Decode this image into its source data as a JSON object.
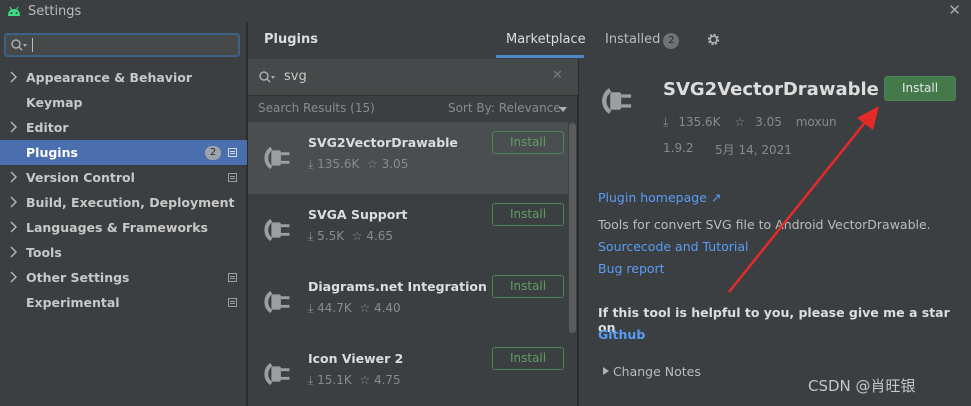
{
  "window": {
    "title": "Settings",
    "close_glyph": "✕"
  },
  "sidebar": {
    "search_value": "",
    "items": [
      {
        "label": "Appearance & Behavior",
        "expandable": true
      },
      {
        "label": "Keymap",
        "expandable": false
      },
      {
        "label": "Editor",
        "expandable": true
      },
      {
        "label": "Plugins",
        "expandable": false,
        "badge": "2",
        "selected": true
      },
      {
        "label": "Version Control",
        "expandable": true
      },
      {
        "label": "Build, Execution, Deployment",
        "expandable": true
      },
      {
        "label": "Languages & Frameworks",
        "expandable": true
      },
      {
        "label": "Tools",
        "expandable": true
      },
      {
        "label": "Other Settings",
        "expandable": true
      },
      {
        "label": "Experimental",
        "expandable": false
      }
    ]
  },
  "header": {
    "title": "Plugins",
    "tabs": {
      "marketplace": "Marketplace",
      "installed": "Installed",
      "installed_count": "2"
    }
  },
  "list": {
    "query": "svg",
    "results_label": "Search Results (15)",
    "sort_label": "Sort By: Relevance",
    "install_label": "Install",
    "plugins": [
      {
        "name": "SVG2VectorDrawable",
        "downloads": "135.6K",
        "rating": "3.05"
      },
      {
        "name": "SVGA Support",
        "downloads": "5.5K",
        "rating": "4.65"
      },
      {
        "name": "Diagrams.net Integration",
        "downloads": "44.7K",
        "rating": "4.40"
      },
      {
        "name": "Icon Viewer 2",
        "downloads": "15.1K",
        "rating": "4.75"
      }
    ]
  },
  "detail": {
    "name": "SVG2VectorDrawable",
    "install_label": "Install",
    "downloads": "135.6K",
    "rating": "3.05",
    "vendor": "moxun",
    "version": "1.9.2",
    "date": "5月 14, 2021",
    "homepage_label": "Plugin homepage ↗",
    "description": "Tools for convert SVG file to Android VectorDrawable.",
    "sourcecode_label": "Sourcecode and Tutorial",
    "bug_label": "Bug report",
    "help_text": "If this tool is helpful to you, please give me a star on",
    "github_label": "Github",
    "change_notes_label": "Change Notes"
  },
  "watermark": "CSDN @肖旺银",
  "colors": {
    "accent": "#4b6eaf",
    "link": "#589df6",
    "install_green": "#447a4b",
    "annotation_red": "#e52a2a"
  }
}
